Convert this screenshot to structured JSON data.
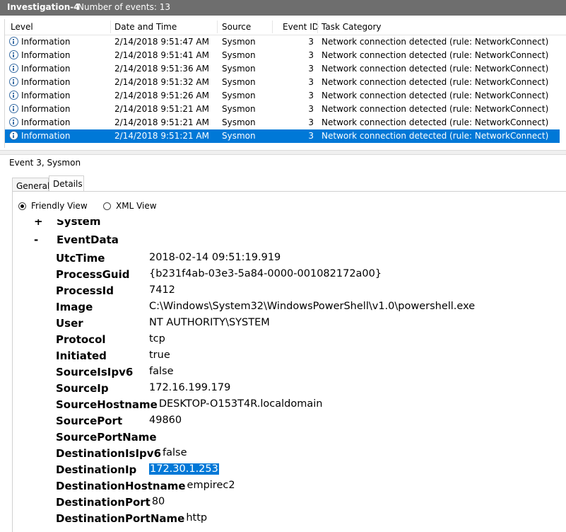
{
  "title_bar": {
    "title": "Investigation-4",
    "count": "Number of events: 13"
  },
  "events_table": {
    "columns": [
      "Level",
      "Date and Time",
      "Source",
      "Event ID",
      "Task Category"
    ],
    "rows": [
      {
        "level": "Information",
        "date": "2/14/2018 9:51:47 AM",
        "source": "Sysmon",
        "id": "3",
        "category": "Network connection detected (rule: NetworkConnect)"
      },
      {
        "level": "Information",
        "date": "2/14/2018 9:51:41 AM",
        "source": "Sysmon",
        "id": "3",
        "category": "Network connection detected (rule: NetworkConnect)"
      },
      {
        "level": "Information",
        "date": "2/14/2018 9:51:36 AM",
        "source": "Sysmon",
        "id": "3",
        "category": "Network connection detected (rule: NetworkConnect)"
      },
      {
        "level": "Information",
        "date": "2/14/2018 9:51:32 AM",
        "source": "Sysmon",
        "id": "3",
        "category": "Network connection detected (rule: NetworkConnect)"
      },
      {
        "level": "Information",
        "date": "2/14/2018 9:51:26 AM",
        "source": "Sysmon",
        "id": "3",
        "category": "Network connection detected (rule: NetworkConnect)"
      },
      {
        "level": "Information",
        "date": "2/14/2018 9:51:21 AM",
        "source": "Sysmon",
        "id": "3",
        "category": "Network connection detected (rule: NetworkConnect)"
      },
      {
        "level": "Information",
        "date": "2/14/2018 9:51:21 AM",
        "source": "Sysmon",
        "id": "3",
        "category": "Network connection detected (rule: NetworkConnect)"
      },
      {
        "level": "Information",
        "date": "2/14/2018 9:51:21 AM",
        "source": "Sysmon",
        "id": "3",
        "category": "Network connection detected (rule: NetworkConnect)"
      }
    ],
    "selected_index": 7,
    "icon": "info-icon",
    "selection_color": "#0078d7"
  },
  "event_header": "Event 3, Sysmon",
  "tabs": {
    "general": "General",
    "details": "Details",
    "active": "Details"
  },
  "view_options": {
    "friendly": "Friendly View",
    "xml": "XML View",
    "selected": "Friendly View"
  },
  "tree": {
    "system": {
      "sign": "+",
      "label": "System"
    },
    "eventdata": {
      "sign": "-",
      "label": "EventData"
    }
  },
  "event_data": [
    {
      "key": "UtcTime",
      "value": "2018-02-14 09:51:19.919"
    },
    {
      "key": "ProcessGuid",
      "value": "{b231f4ab-03e3-5a84-0000-001082172a00}"
    },
    {
      "key": "ProcessId",
      "value": "7412"
    },
    {
      "key": "Image",
      "value": "C:\\Windows\\System32\\WindowsPowerShell\\v1.0\\powershell.exe"
    },
    {
      "key": "User",
      "value": "NT AUTHORITY\\SYSTEM"
    },
    {
      "key": "Protocol",
      "value": "tcp"
    },
    {
      "key": "Initiated",
      "value": "true"
    },
    {
      "key": "SourceIsIpv6",
      "value": "false"
    },
    {
      "key": "SourceIp",
      "value": "172.16.199.179"
    },
    {
      "key": "SourceHostname",
      "value": "DESKTOP-O153T4R.localdomain"
    },
    {
      "key": "SourcePort",
      "value": "49860"
    },
    {
      "key": "SourcePortName",
      "value": ""
    },
    {
      "key": "DestinationIsIpv6",
      "value": "false"
    },
    {
      "key": "DestinationIp",
      "value": "172.30.1.253"
    },
    {
      "key": "DestinationHostname",
      "value": "empirec2"
    },
    {
      "key": "DestinationPort",
      "value": "80"
    },
    {
      "key": "DestinationPortName",
      "value": "http"
    }
  ],
  "highlighted_field": "DestinationIp"
}
